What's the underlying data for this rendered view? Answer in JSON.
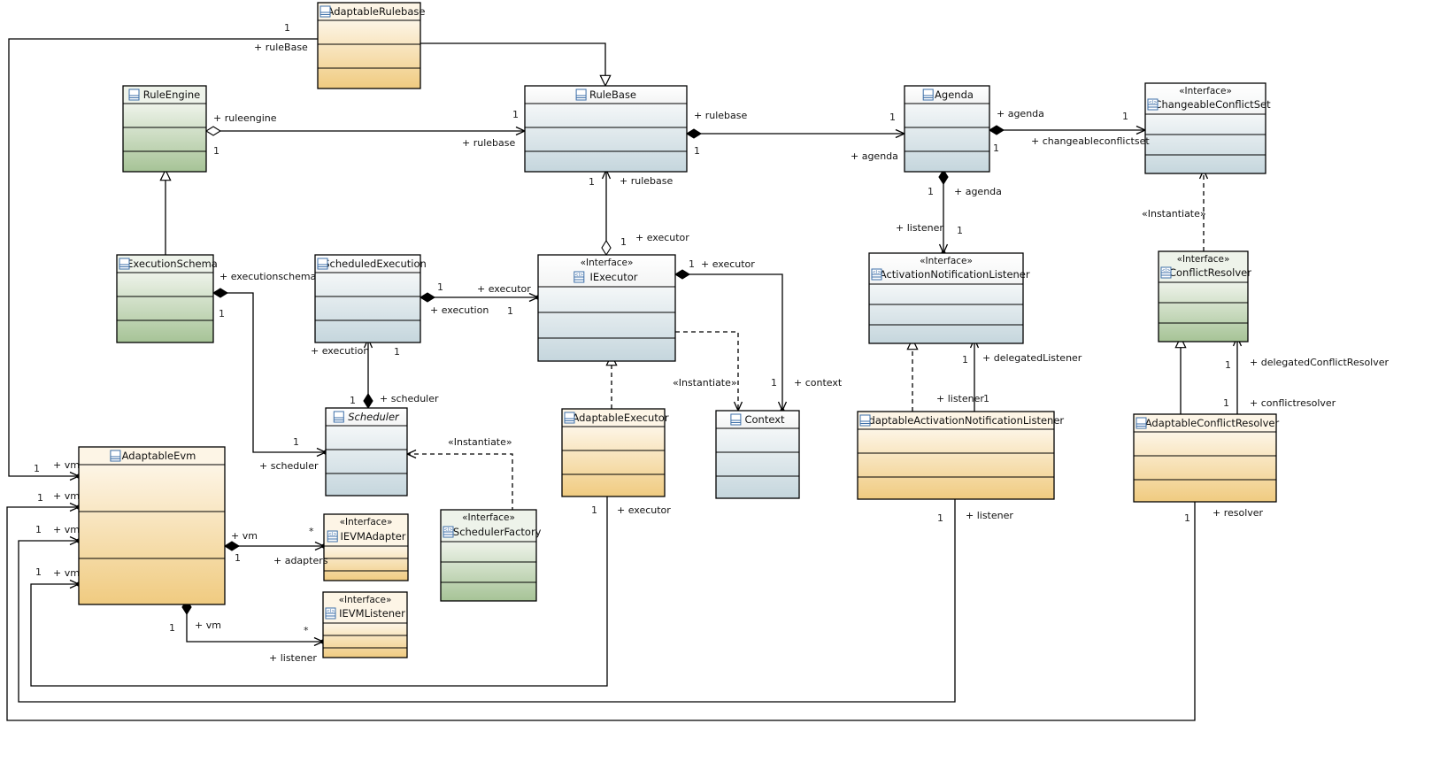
{
  "diagram": {
    "type": "UML class diagram",
    "stereotype_interface": "«Interface»",
    "stereotype_instantiate": "«Instantiate»",
    "palettes": {
      "orange": [
        "#fdf5e6",
        "#f0cb80"
      ],
      "green": [
        "#eef3ea",
        "#a6c396"
      ],
      "blue": [
        "#f4f7f8",
        "#c5d6dd"
      ]
    },
    "classes": [
      {
        "id": "AdaptableRulebase",
        "name": "AdaptableRulebase",
        "palette": "orange",
        "interface": false,
        "italic": false
      },
      {
        "id": "RuleEngine",
        "name": "RuleEngine",
        "palette": "green",
        "interface": false,
        "italic": false
      },
      {
        "id": "RuleBase",
        "name": "RuleBase",
        "palette": "blue",
        "interface": false,
        "italic": false
      },
      {
        "id": "Agenda",
        "name": "Agenda",
        "palette": "blue",
        "interface": false,
        "italic": false
      },
      {
        "id": "ChangeableConflictSet",
        "name": "ChangeableConflictSet",
        "palette": "blue",
        "interface": true,
        "italic": false
      },
      {
        "id": "ExecutionSchema",
        "name": "ExecutionSchema",
        "palette": "green",
        "interface": false,
        "italic": false
      },
      {
        "id": "ScheduledExecution",
        "name": "ScheduledExecution",
        "palette": "blue",
        "interface": false,
        "italic": false
      },
      {
        "id": "IExecutor",
        "name": "IExecutor",
        "palette": "blue",
        "interface": true,
        "italic": false
      },
      {
        "id": "IActivationNotificationListener",
        "name": "IActivationNotificationListener",
        "palette": "blue",
        "interface": true,
        "italic": false
      },
      {
        "id": "ConflictResolver",
        "name": "ConflictResolver",
        "palette": "green",
        "interface": true,
        "italic": false
      },
      {
        "id": "Scheduler",
        "name": "Scheduler",
        "palette": "blue",
        "interface": false,
        "italic": true
      },
      {
        "id": "AdaptableExecutor",
        "name": "AdaptableExecutor",
        "palette": "orange",
        "interface": false,
        "italic": false
      },
      {
        "id": "Context",
        "name": "Context",
        "palette": "blue",
        "interface": false,
        "italic": false
      },
      {
        "id": "AdaptableActivationNotificationListener",
        "name": "AdaptableActivationNotificationListener",
        "palette": "orange",
        "interface": false,
        "italic": false
      },
      {
        "id": "AdaptableConflictResolver",
        "name": "AdaptableConflictResolver",
        "palette": "orange",
        "interface": false,
        "italic": false
      },
      {
        "id": "AdaptableEvm",
        "name": "AdaptableEvm",
        "palette": "orange",
        "interface": false,
        "italic": false
      },
      {
        "id": "IEVMAdapter",
        "name": "IEVMAdapter",
        "palette": "orange",
        "interface": true,
        "italic": false
      },
      {
        "id": "IEVMListener",
        "name": "IEVMListener",
        "palette": "orange",
        "interface": true,
        "italic": false
      },
      {
        "id": "ISchedulerFactory",
        "name": "ISchedulerFactory",
        "palette": "green",
        "interface": true,
        "italic": false
      }
    ],
    "relationships": [
      {
        "kind": "generalization",
        "from": "AdaptableRulebase",
        "to": "RuleBase"
      },
      {
        "kind": "generalization",
        "from": "ExecutionSchema",
        "to": "RuleEngine"
      },
      {
        "kind": "realization",
        "from": "AdaptableExecutor",
        "to": "IExecutor"
      },
      {
        "kind": "realization",
        "from": "AdaptableActivationNotificationListener",
        "to": "IActivationNotificationListener"
      },
      {
        "kind": "generalization",
        "from": "AdaptableConflictResolver",
        "to": "ConflictResolver"
      },
      {
        "kind": "instantiate",
        "from": "IExecutor",
        "to": "Context"
      },
      {
        "kind": "instantiate",
        "from": "ISchedulerFactory",
        "to": "Scheduler"
      },
      {
        "kind": "instantiate",
        "from": "ConflictResolver",
        "to": "ChangeableConflictSet"
      },
      {
        "kind": "aggregation",
        "from": "RuleEngine",
        "to": "RuleBase",
        "src_role": "+ ruleengine",
        "src_mult": "1",
        "dst_role": "+ rulebase",
        "dst_mult": "1"
      },
      {
        "kind": "composition",
        "from": "RuleBase",
        "to": "Agenda",
        "src_role": "+ rulebase",
        "src_mult": "1",
        "dst_role": "+ agenda",
        "dst_mult": "1"
      },
      {
        "kind": "composition",
        "from": "Agenda",
        "to": "ChangeableConflictSet",
        "src_role": "+ agenda",
        "src_mult": "1",
        "dst_role": "+ changeableconflictset",
        "dst_mult": "1"
      },
      {
        "kind": "aggregation",
        "from": "IExecutor",
        "to": "RuleBase",
        "src_role": "+ executor",
        "src_mult": "1",
        "dst_role": "+ rulebase",
        "dst_mult": "1"
      },
      {
        "kind": "composition",
        "from": "Agenda",
        "to": "IActivationNotificationListener",
        "src_role": "+ agenda",
        "src_mult": "1",
        "dst_role": "+ listener",
        "dst_mult": "1"
      },
      {
        "kind": "composition",
        "from": "ScheduledExecution",
        "to": "IExecutor",
        "src_role": "+ execution",
        "src_mult": "1",
        "dst_role": "+ executor",
        "dst_mult": "1"
      },
      {
        "kind": "composition",
        "from": "IExecutor",
        "to": "Context",
        "src_role": "+ executor",
        "src_mult": "1",
        "dst_role": "+ context",
        "dst_mult": "1"
      },
      {
        "kind": "composition",
        "from": "ExecutionSchema",
        "to": "Scheduler",
        "src_role": "+ executionschema",
        "src_mult": "1",
        "dst_role": "+ scheduler",
        "dst_mult": "1"
      },
      {
        "kind": "composition",
        "from": "Scheduler",
        "to": "ScheduledExecution",
        "src_role": "+ scheduler",
        "src_mult": "1",
        "dst_role": "+ execution",
        "dst_mult": "1"
      },
      {
        "kind": "association",
        "from": "AdaptableActivationNotificationListener",
        "to": "IActivationNotificationListener",
        "src_role": "+ listener",
        "src_mult": "1",
        "dst_role": "+ delegatedListener",
        "dst_mult": "1"
      },
      {
        "kind": "association",
        "from": "AdaptableConflictResolver",
        "to": "ConflictResolver",
        "src_role": "+ conflictresolver",
        "src_mult": "1",
        "dst_role": "+ delegatedConflictResolver",
        "dst_mult": "1"
      },
      {
        "kind": "composition",
        "from": "AdaptableEvm",
        "to": "IEVMAdapter",
        "src_role": "+ vm",
        "src_mult": "1",
        "dst_role": "+ adapters",
        "dst_mult": "*"
      },
      {
        "kind": "composition",
        "from": "AdaptableEvm",
        "to": "IEVMListener",
        "src_role": "+ vm",
        "src_mult": "1",
        "dst_role": "+ listener",
        "dst_mult": "*"
      },
      {
        "kind": "association",
        "from": "AdaptableRulebase",
        "to": "AdaptableEvm",
        "src_role": "+ ruleBase",
        "src_mult": "1",
        "dst_role": "+ vm",
        "dst_mult": "1"
      },
      {
        "kind": "association",
        "from": "AdaptableConflictResolver",
        "to": "AdaptableEvm",
        "src_role": "+ resolver",
        "src_mult": "1",
        "dst_role": "+ vm",
        "dst_mult": "1"
      },
      {
        "kind": "association",
        "from": "AdaptableActivationNotificationListener",
        "to": "AdaptableEvm",
        "src_role": "+ listener",
        "src_mult": "1",
        "dst_role": "+ vm",
        "dst_mult": "1"
      },
      {
        "kind": "association",
        "from": "AdaptableExecutor",
        "to": "AdaptableEvm",
        "src_role": "+ executor",
        "src_mult": "1",
        "dst_role": "+ vm",
        "dst_mult": "1"
      }
    ]
  }
}
